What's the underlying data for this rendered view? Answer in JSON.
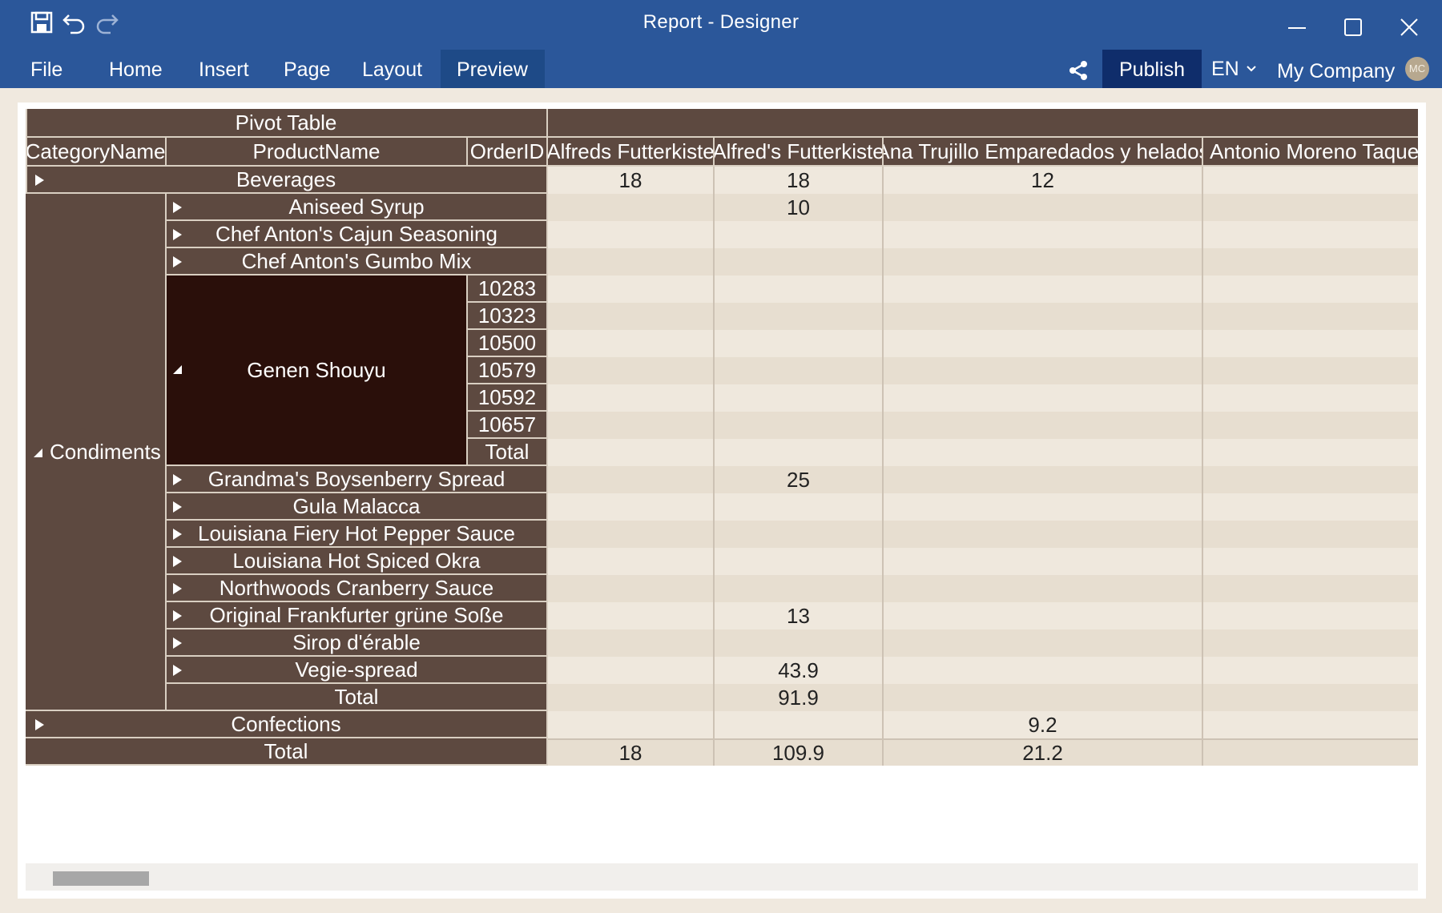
{
  "window": {
    "title": "Report - Designer"
  },
  "toolbar": {
    "save_icon": "save-icon",
    "undo_icon": "undo-icon",
    "redo_icon": "redo-icon"
  },
  "menu": {
    "items": [
      {
        "label": "File"
      },
      {
        "label": "Home"
      },
      {
        "label": "Insert"
      },
      {
        "label": "Page"
      },
      {
        "label": "Layout"
      },
      {
        "label": "Preview"
      }
    ],
    "active": "Preview",
    "publish_label": "Publish",
    "language": "EN",
    "company": "My Company",
    "avatar_initials": "MC"
  },
  "colors": {
    "ribbon": "#2b579a",
    "active_tab": "#1e4a87",
    "publish": "#0f2d6b",
    "header_cell": "#5d4940",
    "selected_cell": "#2a0f0a",
    "row_light": "#efe8dd",
    "row_dark": "#e7ded0"
  },
  "pivot": {
    "title": "Pivot Table",
    "row_headers": [
      "CategoryName",
      "ProductName",
      "OrderID"
    ],
    "columns": [
      "Alfreds Futterkiste",
      "Alfred's Futterkiste",
      "Ana Trujillo Emparedados y helados",
      "Antonio Moreno Taquería"
    ],
    "categories": {
      "beverages": "Beverages",
      "condiments": "Condiments",
      "confections": "Confections"
    },
    "products": [
      "Aniseed Syrup",
      "Chef Anton's Cajun Seasoning",
      "Chef Anton's Gumbo Mix",
      "Genen Shouyu",
      "Grandma's Boysenberry Spread",
      "Gula Malacca",
      "Louisiana Fiery Hot Pepper Sauce",
      "Louisiana Hot Spiced Okra",
      "Northwoods Cranberry Sauce",
      "Original Frankfurter grüne Soße",
      "Sirop d'érable",
      "Vegie-spread"
    ],
    "order_ids": [
      "10283",
      "10323",
      "10500",
      "10579",
      "10592",
      "10657"
    ],
    "total_label": "Total",
    "values": {
      "beverages": [
        "18",
        "18",
        "12",
        ""
      ],
      "aniseed_syrup": [
        "",
        "10",
        "",
        ""
      ],
      "grandmas": [
        "",
        "25",
        "",
        ""
      ],
      "frankfurter": [
        "",
        "13",
        "",
        ""
      ],
      "vegie": [
        "",
        "43.9",
        "",
        ""
      ],
      "condiments_total": [
        "",
        "91.9",
        "",
        ""
      ],
      "confections": [
        "",
        "",
        "9.2",
        ""
      ],
      "grand_total": [
        "18",
        "109.9",
        "21.2",
        ""
      ]
    }
  }
}
